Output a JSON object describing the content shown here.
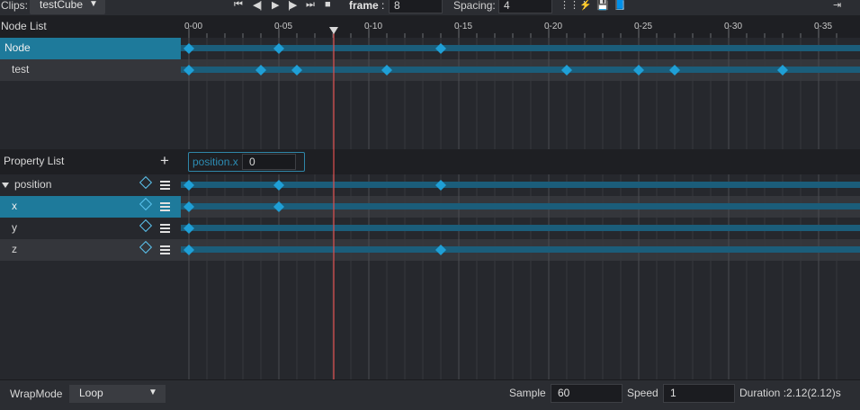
{
  "topbar": {
    "clips_label": "Clips:",
    "clip_name": "testCube",
    "frame_label": "frame",
    "frame_colon": ":",
    "frame_value": "8",
    "spacing_label": "Spacing:",
    "spacing_value": "4",
    "controls": [
      "first-frame",
      "prev-frame",
      "play",
      "next-frame",
      "last-frame",
      "stop"
    ],
    "tools": [
      "grid-icon",
      "event-icon",
      "save-icon",
      "book-icon",
      "exit-icon"
    ]
  },
  "node_list": {
    "title": "Node List",
    "nodes": [
      {
        "label": "Node",
        "selected": true,
        "keys": [
          0,
          5,
          14
        ]
      },
      {
        "label": "test",
        "selected": false,
        "keys": [
          0,
          4,
          6,
          11,
          21,
          25,
          27,
          33
        ]
      }
    ]
  },
  "property_list": {
    "title": "Property List",
    "current_property": "position.x",
    "current_value": "0",
    "rows": [
      {
        "label": "position",
        "group": true,
        "keys": [
          0,
          5,
          14
        ]
      },
      {
        "label": "x",
        "selected": true,
        "keys": [
          0,
          5
        ]
      },
      {
        "label": "y",
        "keys": [
          0
        ]
      },
      {
        "label": "z",
        "keys": [
          0,
          14
        ]
      }
    ]
  },
  "timeline": {
    "ticks": [
      "0-00",
      "0-05",
      "0-10",
      "0-15",
      "0-20",
      "0-25",
      "0-30",
      "0-35"
    ],
    "frames_per_label": 5,
    "visible_frames": 37,
    "playhead_frame": 8,
    "colors": {
      "keyframe": "#1f9fd6",
      "track": "#1b5d7a",
      "playhead": "#e0504f"
    }
  },
  "bottombar": {
    "wrapmode_label": "WrapMode",
    "wrapmode_value": "Loop",
    "sample_label": "Sample",
    "sample_value": "60",
    "speed_label": "Speed",
    "speed_value": "1",
    "duration_text": "Duration :2.12(2.12)s"
  }
}
